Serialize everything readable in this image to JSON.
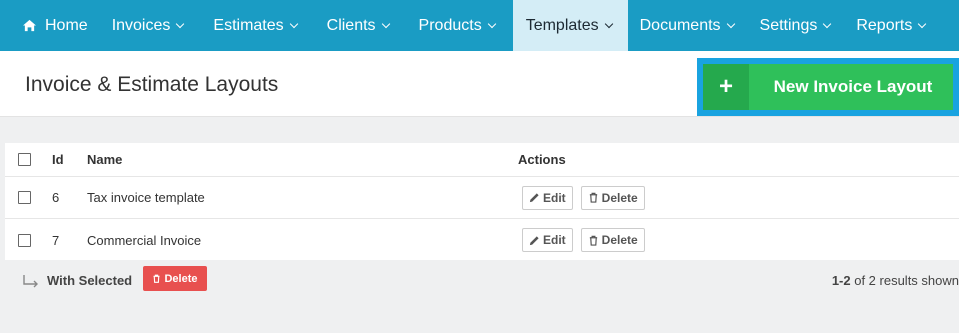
{
  "nav": {
    "items": [
      {
        "label": "Home"
      },
      {
        "label": "Invoices"
      },
      {
        "label": "Estimates"
      },
      {
        "label": "Clients"
      },
      {
        "label": "Products"
      },
      {
        "label": "Templates"
      },
      {
        "label": "Documents"
      },
      {
        "label": "Settings"
      },
      {
        "label": "Reports"
      }
    ],
    "active": "Templates"
  },
  "header": {
    "title": "Invoice & Estimate Layouts",
    "new_button_plus": "+",
    "new_button_label": "New Invoice Layout"
  },
  "table": {
    "columns": {
      "id": "Id",
      "name": "Name",
      "actions": "Actions"
    },
    "rows": [
      {
        "id": "6",
        "name": "Tax invoice template",
        "edit": "Edit",
        "delete": "Delete"
      },
      {
        "id": "7",
        "name": "Commercial Invoice",
        "edit": "Edit",
        "delete": "Delete"
      }
    ]
  },
  "footer": {
    "with_selected": "With Selected",
    "bulk_delete": "Delete",
    "results_range": "1-2",
    "results_text": " of 2 results shown"
  },
  "colors": {
    "nav_bg": "#1a9cc4",
    "nav_active_bg": "#d4edf6",
    "new_button_bg": "#2fc05a",
    "new_button_border": "#19a3e0",
    "bulk_delete_bg": "#e8504f"
  }
}
